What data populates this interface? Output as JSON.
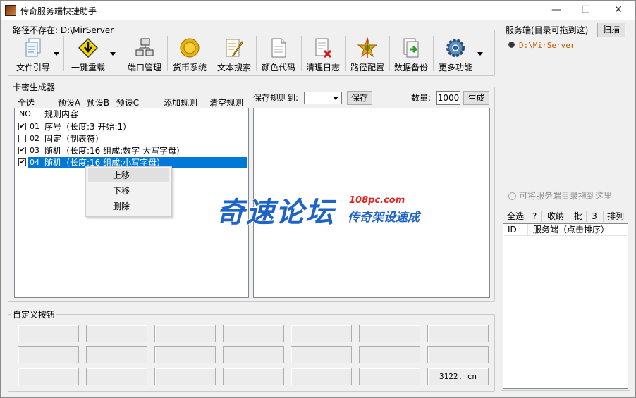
{
  "window": {
    "title": "传奇服务端快捷助手",
    "minimize": "—",
    "maximize": "☐",
    "close": "✕"
  },
  "path_group": {
    "legend": "路径不存在: D:\\MirServer"
  },
  "toolbar": [
    {
      "label": "文件引导",
      "icon": "files-icon"
    },
    {
      "label": "一键重载",
      "icon": "download-arrow-icon"
    },
    {
      "label": "端口管理",
      "icon": "network-icon"
    },
    {
      "label": "货币系统",
      "icon": "coin-icon"
    },
    {
      "label": "文本搜索",
      "icon": "text-edit-icon"
    },
    {
      "label": "颜色代码",
      "icon": "document-icon"
    },
    {
      "label": "清理日志",
      "icon": "delete-log-icon"
    },
    {
      "label": "路径配置",
      "icon": "star-config-icon"
    },
    {
      "label": "数据备份",
      "icon": "backup-icon"
    },
    {
      "label": "更多功能",
      "icon": "gear-icon"
    }
  ],
  "card_gen": {
    "legend": "卡密生成器",
    "select_all": "全选",
    "presetA": "预设A",
    "presetB": "预设B",
    "presetC": "预设C",
    "add_rule": "添加规则",
    "clear_rule": "清空规则",
    "save_rule_label": "保存规则到:",
    "save": "保存",
    "qty_label": "数量:",
    "qty_value": "1000",
    "generate": "生成",
    "col_no": "NO.",
    "col_rule": "规则内容",
    "rows": [
      {
        "no": "01",
        "text": "序号（长度:3  开始:1）",
        "checked": true
      },
      {
        "no": "02",
        "text": "固定（制表符）",
        "checked": false
      },
      {
        "no": "03",
        "text": "随机（长度:16  组成:数字 大写字母）",
        "checked": true
      },
      {
        "no": "04",
        "text": "随机（长度:16  组成:小写字母）",
        "checked": true
      }
    ]
  },
  "context_menu": {
    "up": "上移",
    "down": "下移",
    "delete": "删除"
  },
  "watermark": {
    "main": "奇速论坛",
    "site": "108pc.com",
    "slogan": "传奇架设速成"
  },
  "custom_buttons": {
    "legend": "自定义按钮",
    "last_label": "3122. cn"
  },
  "server_panel": {
    "legend": "服务端(目录可拖到这)",
    "scan": "扫描",
    "server_path": "D:\\MirServer",
    "drop_hint": "可将服务端目录拖到这里",
    "select_all": "全选",
    "q": "?",
    "collapse": "收纳",
    "batch": "批",
    "num": "3",
    "sort": "排列",
    "col_id": "ID",
    "col_server": "服务端（点击排序）"
  }
}
